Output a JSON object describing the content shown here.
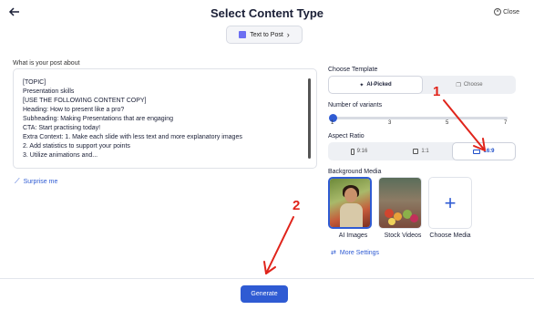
{
  "header": {
    "title": "Select Content Type",
    "close_label": "Close"
  },
  "content_type_pill": {
    "label": "Text to Post"
  },
  "prompt": {
    "label": "What is your post about",
    "lines": [
      "[TOPIC]",
      "Presentation skills",
      "[USE THE FOLLOWING CONTENT COPY]",
      "Heading: How to present like a pro?",
      "Subheading: Making Presentations that are engaging",
      "CTA: Start practising today!",
      "Extra Context: 1. Make each slide with less text and more explanatory images",
      "2. Add statistics to support your points",
      "3. Utilize animations and..."
    ]
  },
  "surprise_me": {
    "label": "Surprise me"
  },
  "template": {
    "label": "Choose Template",
    "options": [
      {
        "label": "AI-Picked",
        "active": true
      },
      {
        "label": "Choose",
        "active": false
      }
    ]
  },
  "variants": {
    "label": "Number of variants",
    "ticks": [
      "1",
      "3",
      "5",
      "7"
    ],
    "value": 1
  },
  "aspect_ratio": {
    "label": "Aspect Ratio",
    "options": [
      {
        "label": "9:16",
        "active": false
      },
      {
        "label": "1:1",
        "active": false
      },
      {
        "label": "16:9",
        "active": true
      }
    ]
  },
  "background_media": {
    "label": "Background Media",
    "options": [
      {
        "label": "AI Images",
        "selected": true
      },
      {
        "label": "Stock Videos",
        "selected": false
      },
      {
        "label": "Choose Media",
        "selected": false
      }
    ]
  },
  "more_settings": {
    "label": "More Settings"
  },
  "generate": {
    "label": "Generate"
  },
  "annotations": {
    "first": "1",
    "second": "2",
    "color": "#e0241b"
  },
  "colors": {
    "accent": "#2f5bd3",
    "text": "#1a1f36"
  }
}
